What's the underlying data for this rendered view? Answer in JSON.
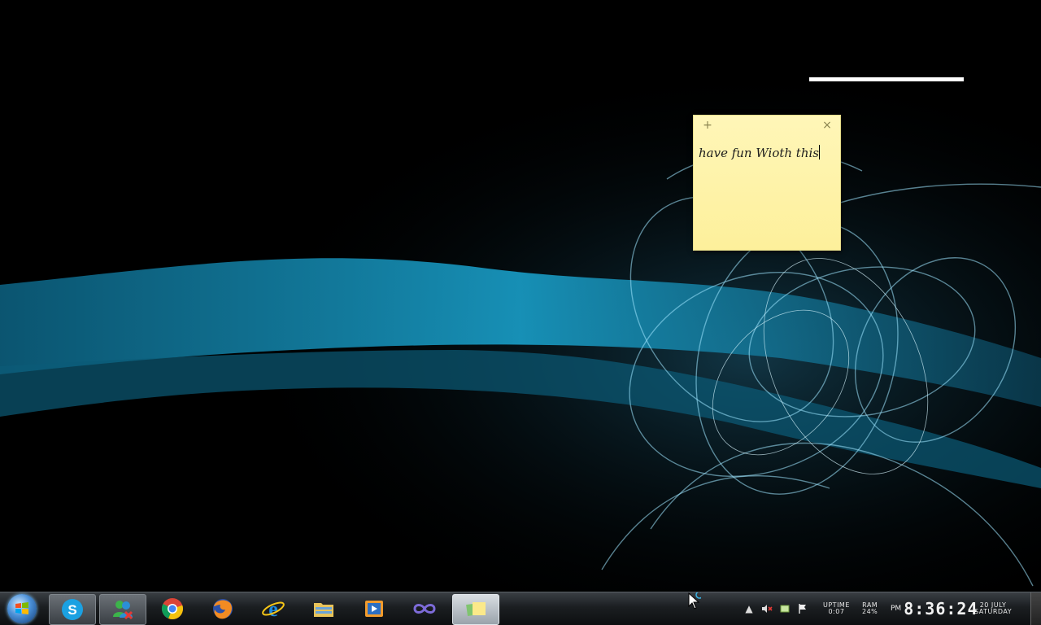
{
  "sticky_note": {
    "add_glyph": "+",
    "close_glyph": "×",
    "text": "have fun Wioth this"
  },
  "taskbar": {
    "pinned": [
      {
        "name": "skype-icon",
        "state": "open"
      },
      {
        "name": "messenger-icon",
        "state": "open"
      },
      {
        "name": "chrome-icon",
        "state": "pinned"
      },
      {
        "name": "firefox-icon",
        "state": "pinned"
      },
      {
        "name": "internet-explorer-icon",
        "state": "pinned"
      },
      {
        "name": "file-explorer-icon",
        "state": "pinned"
      },
      {
        "name": "media-player-icon",
        "state": "pinned"
      },
      {
        "name": "infinity-app-icon",
        "state": "pinned"
      },
      {
        "name": "sticky-notes-icon",
        "state": "active"
      }
    ],
    "tray": {
      "uptime_label": "UPTIME",
      "uptime_value": "0:07",
      "ram_label": "RAM",
      "ram_value": "24%",
      "ampm": "PM",
      "time": "8:36:24",
      "date": "20 JULY",
      "day": "SATURDAY"
    }
  },
  "colors": {
    "accent_cyan": "#2fb4e0",
    "sticky_yellow": "#fdf09b"
  }
}
